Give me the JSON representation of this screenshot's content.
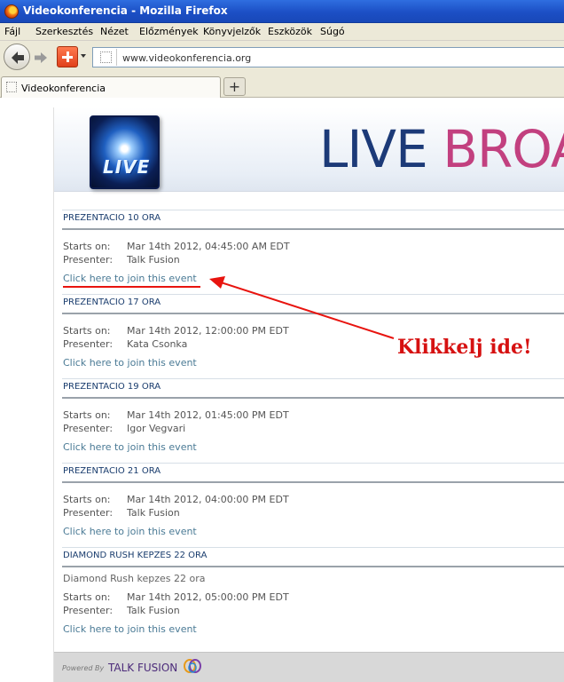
{
  "window": {
    "title": "Videokonferencia - Mozilla Firefox"
  },
  "menu": [
    "Fájl",
    "Szerkesztés",
    "Nézet",
    "Előzmények",
    "Könyvjelzők",
    "Eszközök",
    "Súgó"
  ],
  "address": {
    "url": "www.videokonferencia.org"
  },
  "tabs": [
    {
      "label": "Videokonferencia"
    }
  ],
  "banner": {
    "logo_text": "LIVE",
    "title_part1": "LIVE",
    "title_part2": "BROA"
  },
  "labels": {
    "starts_on": "Starts on:",
    "presenter": "Presenter:"
  },
  "events": [
    {
      "title": "PREZENTACIO 10 ORA",
      "description": "",
      "starts_on": "Mar 14th 2012, 04:45:00 AM EDT",
      "presenter": "Talk Fusion",
      "join": "Click here to join this event"
    },
    {
      "title": "PREZENTACIO 17 ORA",
      "description": "",
      "starts_on": "Mar 14th 2012, 12:00:00 PM EDT",
      "presenter": "Kata Csonka",
      "join": "Click here to join this event"
    },
    {
      "title": "PREZENTACIO 19 ORA",
      "description": "",
      "starts_on": "Mar 14th 2012, 01:45:00 PM EDT",
      "presenter": "Igor Vegvari",
      "join": "Click here to join this event"
    },
    {
      "title": "PREZENTACIO 21 ORA",
      "description": "",
      "starts_on": "Mar 14th 2012, 04:00:00 PM EDT",
      "presenter": "Talk Fusion",
      "join": "Click here to join this event"
    },
    {
      "title": "DIAMOND RUSH KEPZES 22 ORA",
      "description": "Diamond Rush kepzes 22 ora",
      "starts_on": "Mar 14th 2012, 05:00:00 PM EDT",
      "presenter": "Talk Fusion",
      "join": "Click here to join this event"
    }
  ],
  "footer": {
    "powered_by": "Powered By",
    "brand": "TALK FUSION"
  },
  "annotation": {
    "text": "Klikkelj ide!",
    "color": "#d61111"
  },
  "colors": {
    "section_title": "#1a3d6e",
    "join_link": "#4a7a95",
    "banner_blue": "#1c3a78",
    "banner_pink": "#c2407f"
  }
}
